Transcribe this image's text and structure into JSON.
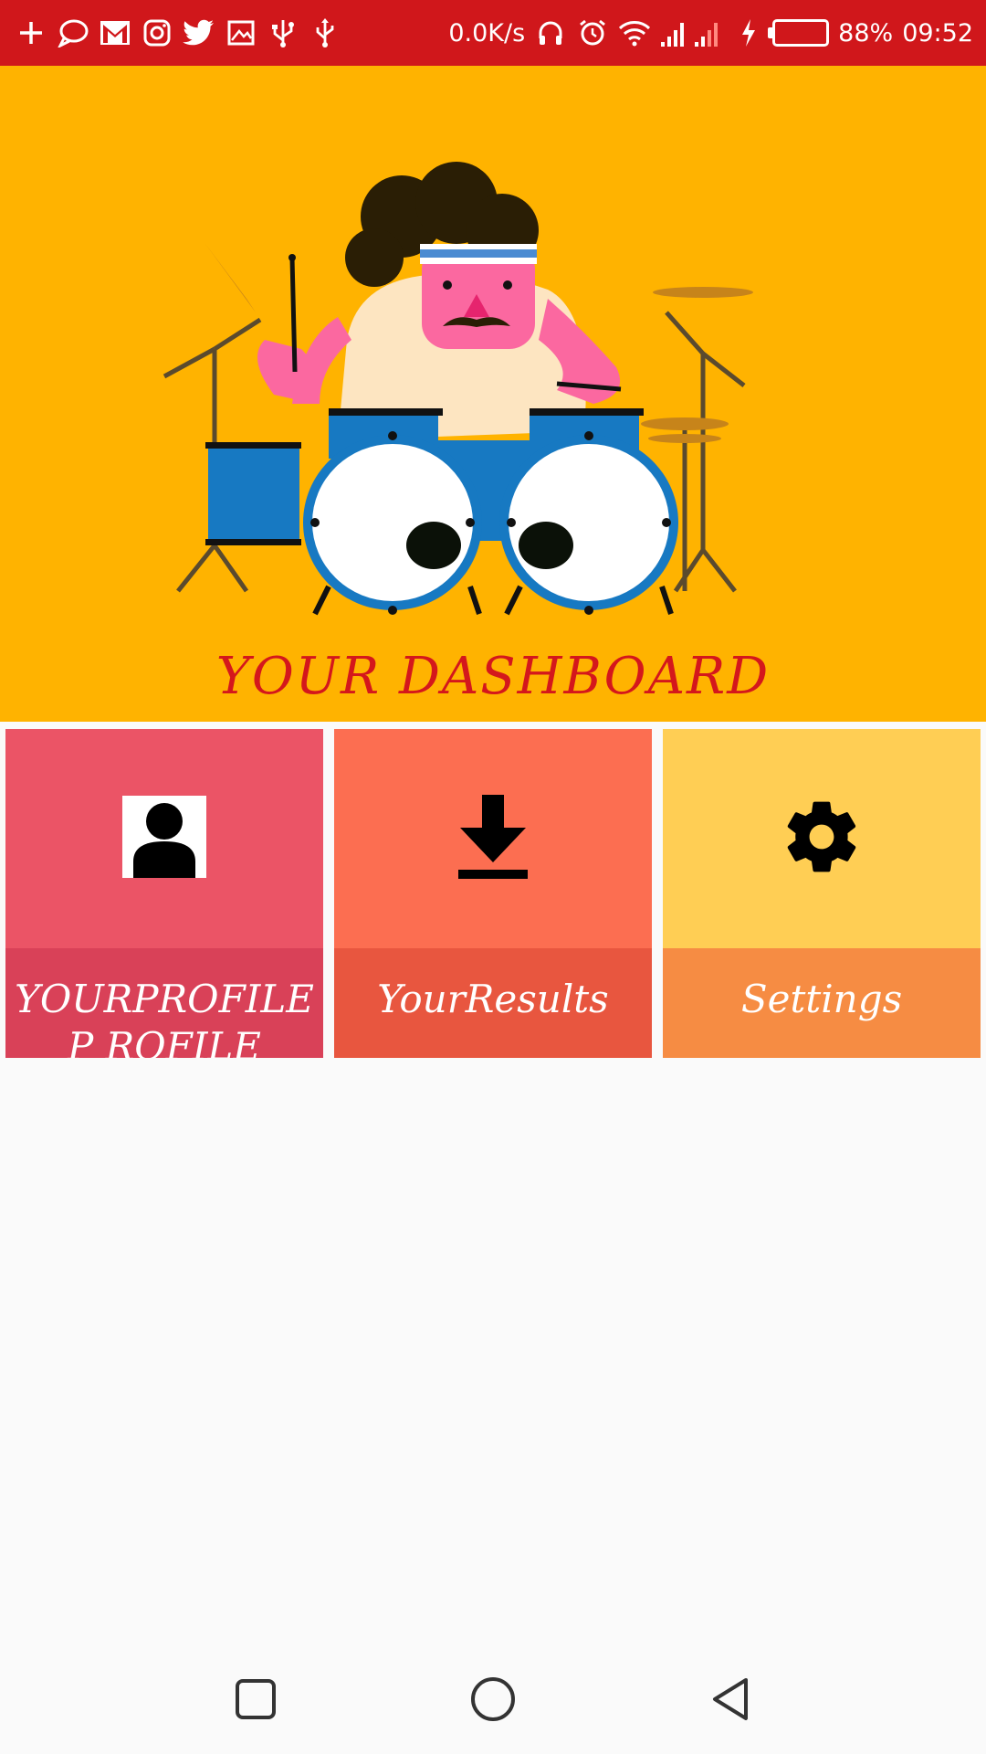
{
  "status_bar": {
    "left_icons": [
      "plus-icon",
      "chat-bubble-icon",
      "gmail-icon",
      "instagram-icon",
      "twitter-icon",
      "screenshot-icon",
      "usb-icon",
      "usb-icon"
    ],
    "network_speed": "0.0K/s",
    "battery_percent": "88%",
    "time": "09:52",
    "battery_level": 0.88,
    "background": "#d0171b"
  },
  "hero": {
    "title": "YOUR DASHBOARD",
    "background": "#ffb300",
    "title_color": "#d4171c"
  },
  "tiles": [
    {
      "label": "YOURPROFILEP ROFILE",
      "icon": "profile-icon",
      "top_color": "#eb5466",
      "bottom_color": "#d94158"
    },
    {
      "label": "YourResults",
      "icon": "download-icon",
      "top_color": "#fc6e51",
      "bottom_color": "#e8563f"
    },
    {
      "label": "Settings",
      "icon": "gear-icon",
      "top_color": "#ffce54",
      "bottom_color": "#f68c43"
    }
  ],
  "nav": {
    "icons": [
      "recent-apps-icon",
      "home-icon",
      "back-icon"
    ]
  }
}
